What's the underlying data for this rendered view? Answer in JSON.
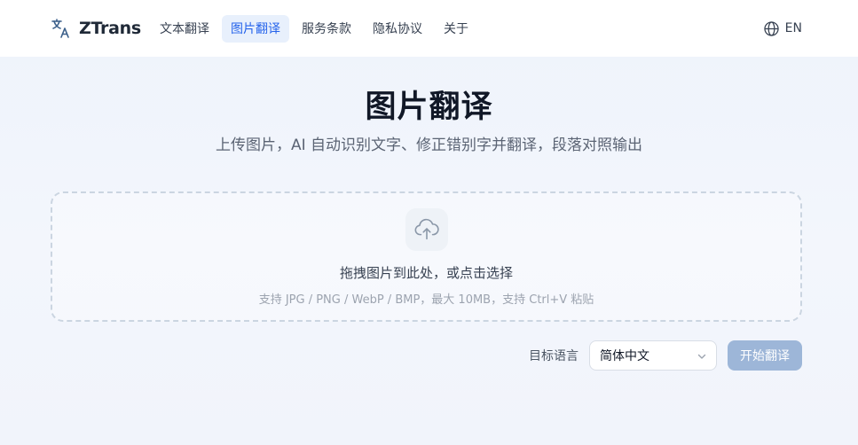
{
  "brand": {
    "name": "ZTrans",
    "icon": "translate-icon"
  },
  "nav": {
    "items": [
      {
        "label": "文本翻译",
        "active": false
      },
      {
        "label": "图片翻译",
        "active": true
      },
      {
        "label": "服务条款",
        "active": false
      },
      {
        "label": "隐私协议",
        "active": false
      },
      {
        "label": "关于",
        "active": false
      }
    ]
  },
  "language_switch": {
    "label": "EN",
    "icon": "globe-icon"
  },
  "hero": {
    "title": "图片翻译",
    "subtitle": "上传图片，AI 自动识别文字、修正错别字并翻译，段落对照输出"
  },
  "dropzone": {
    "icon": "cloud-upload-icon",
    "main_text": "拖拽图片到此处，或点击选择",
    "hint_text": "支持 JPG / PNG / WebP / BMP，最大 10MB，支持 Ctrl+V 粘贴"
  },
  "controls": {
    "target_language_label": "目标语言",
    "target_language_value": "简体中文",
    "start_button_label": "开始翻译"
  },
  "colors": {
    "accent": "#2563eb",
    "active_nav_bg": "#e8f0fc",
    "start_button_bg": "#9db6d8",
    "background": "#eef3fb"
  }
}
